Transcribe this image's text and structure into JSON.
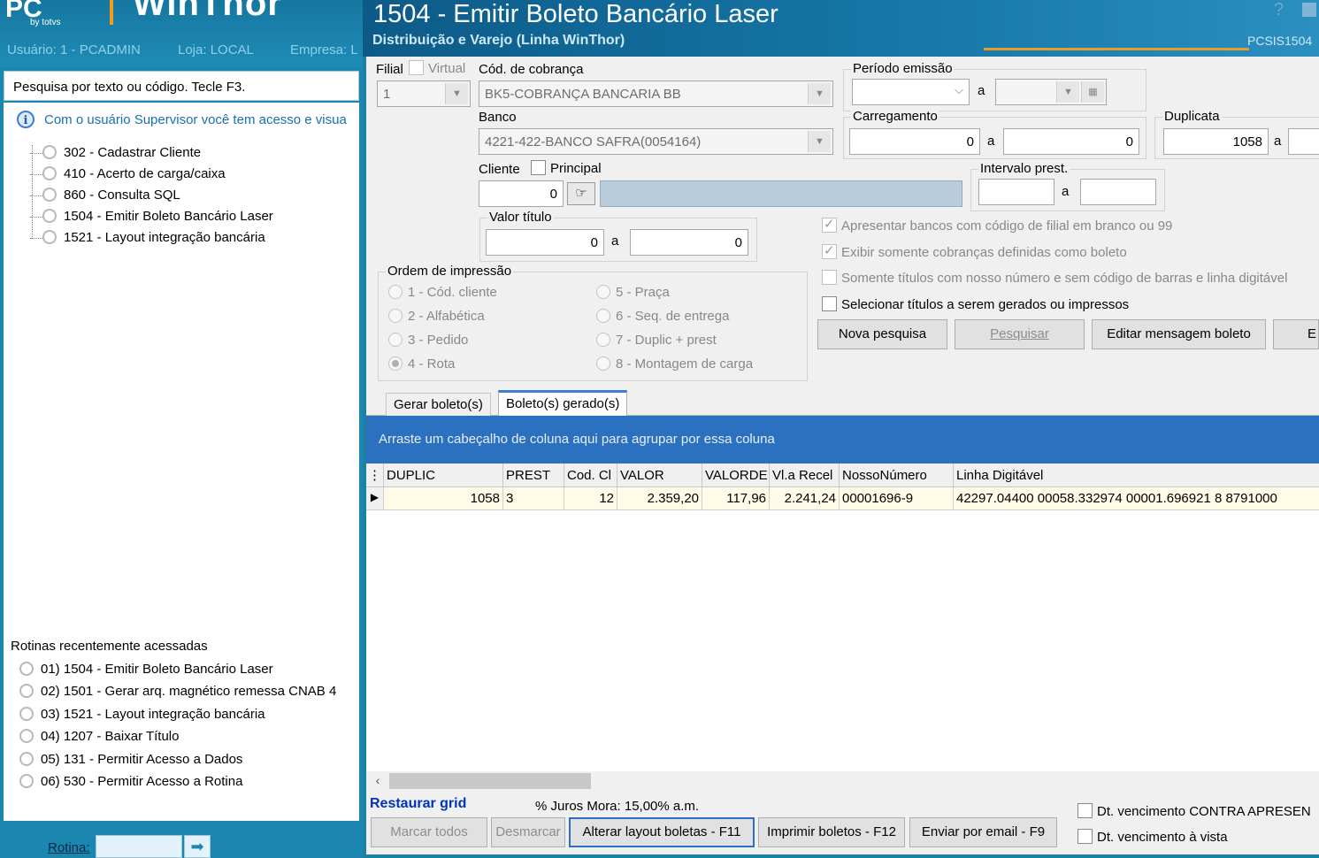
{
  "left": {
    "logo_text": "WinThor",
    "logo_small": "by totvs",
    "user_label": "Usuário: 1 - PCADMIN",
    "store_label": "Loja: LOCAL",
    "company_label": "Empresa: L",
    "search_placeholder": "Pesquisa por texto ou código. Tecle F3.",
    "info_text": "Com o usuário Supervisor você tem acesso e visua",
    "tree_items": [
      "302 - Cadastrar Cliente",
      "410 - Acerto de carga/caixa",
      "860 - Consulta SQL",
      "1504 - Emitir Boleto Bancário Laser",
      "1521 - Layout integração bancária"
    ],
    "recent_title": "Rotinas recentemente acessadas",
    "recent_items": [
      "01)  1504 - Emitir Boleto Bancário Laser",
      "02)  1501 - Gerar arq. magnético remessa CNAB 4",
      "03)  1521 - Layout integração bancária",
      "04)  1207 - Baixar Título",
      "05)  131 - Permitir Acesso a Dados",
      "06)  530 - Permitir Acesso a Rotina"
    ],
    "rotina_label": "Rotina:"
  },
  "header": {
    "title": "1504 - Emitir Boleto Bancário Laser",
    "subtitle": "Distribuição e Varejo (Linha WinThor)",
    "code": "PCSIS1504"
  },
  "form": {
    "filial_label": "Filial",
    "virtual_label": "Virtual",
    "filial_value": "1",
    "cobranca_label": "Cód. de cobrança",
    "cobranca_value": "BK5-COBRANÇA BANCARIA BB",
    "banco_label": "Banco",
    "banco_value": "4221-422-BANCO SAFRA(0054164)",
    "cliente_label": "Cliente",
    "principal_label": "Principal",
    "cliente_value": "0",
    "valor_titulo_label": "Valor título",
    "valor_de": "0",
    "valor_ate": "0",
    "a": "a",
    "periodo_label": "Período emissão",
    "carregamento_label": "Carregamento",
    "carreg_de": "0",
    "carreg_ate": "0",
    "duplicata_label": "Duplicata",
    "duplicata_de": "1058",
    "intervalo_label": "Intervalo prest.",
    "ordem_label": "Ordem de impressão",
    "ordem_options": [
      "1 - Cód. cliente",
      "2 - Alfabética",
      "3 - Pedido",
      "4 - Rota",
      "5 - Praça",
      "6 - Seq. de entrega",
      "7 - Duplic + prest",
      "8 - Montagem de carga"
    ],
    "checks": [
      "Apresentar bancos com código de filial em branco ou 99",
      "Exibir somente cobranças definidas como boleto",
      "Somente títulos com nosso número e sem código de barras e linha digitável",
      "Selecionar títulos a serem gerados ou impressos"
    ],
    "btn_nova": "Nova pesquisa",
    "btn_pesquisar": "Pesquisar",
    "btn_editar": "Editar mensagem boleto",
    "btn_extra": "E"
  },
  "tabs": [
    "Gerar boleto(s)",
    "Boleto(s) gerado(s)"
  ],
  "grid": {
    "group_hint": "Arraste um cabeçalho de coluna aqui para agrupar por essa coluna",
    "columns": [
      "DUPLIC",
      "PREST",
      "Cod. Cl",
      "VALOR",
      "VALORDE",
      "Vl.a Recel",
      "NossoNúmero",
      "Linha Digitável"
    ],
    "rows": [
      [
        "1058",
        "3",
        "12",
        "2.359,20",
        "117,96",
        "2.241,24",
        "00001696-9",
        "42297.04400  00058.332974  00001.696921  8  8791000"
      ]
    ]
  },
  "bottom": {
    "restaurar": "Restaurar grid",
    "juros": "% Juros Mora: 15,00% a.m.",
    "btn_marcar": "Marcar todos",
    "btn_desmarcar": "Desmarcar",
    "btn_alterar": "Alterar layout boletas - F11",
    "btn_imprimir": "Imprimir boletos - F12",
    "btn_email": "Enviar por email - F9",
    "chk_contra": "Dt. vencimento CONTRA APRESEN",
    "chk_vista": "Dt. vencimento à vista"
  },
  "colors": {
    "accent": "#1b86b0",
    "grid_group": "#2b71bf",
    "header": "#0d5a87"
  }
}
